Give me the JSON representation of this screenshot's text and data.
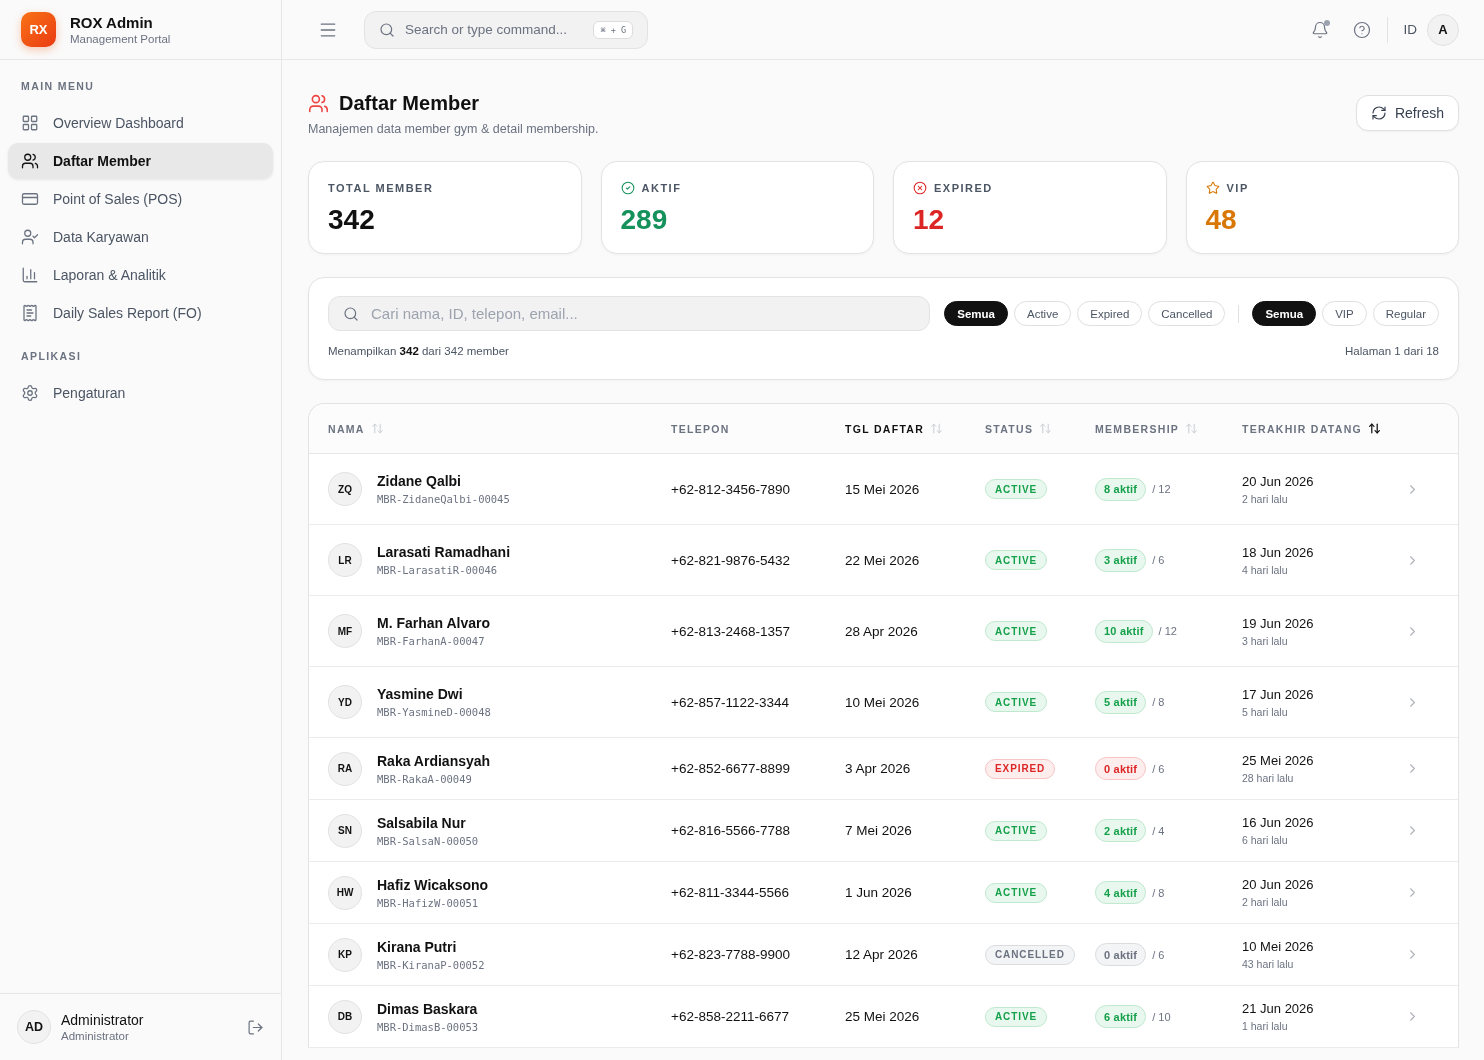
{
  "brand": {
    "logo": "RX",
    "name": "ROX Admin",
    "subtitle": "Management Portal"
  },
  "sidebar": {
    "sections": [
      {
        "title": "MAIN MENU",
        "items": [
          {
            "label": "Overview Dashboard",
            "kind": "dashboard",
            "selected": false
          },
          {
            "label": "Daftar Member",
            "kind": "members",
            "selected": true
          },
          {
            "label": "Point of Sales (POS)",
            "kind": "pos",
            "selected": false
          },
          {
            "label": "Data Karyawan",
            "kind": "employees",
            "selected": false
          },
          {
            "label": "Laporan & Analitik",
            "kind": "reports",
            "selected": false
          },
          {
            "label": "Daily Sales Report (FO)",
            "kind": "sales-report",
            "selected": false
          }
        ]
      },
      {
        "title": "APLIKASI",
        "items": [
          {
            "label": "Pengaturan",
            "kind": "settings",
            "selected": false
          }
        ]
      }
    ],
    "user": {
      "initials": "AD",
      "name": "Administrator",
      "role": "Administrator"
    }
  },
  "topbar": {
    "search": {
      "placeholder": "Search or type command...",
      "shortcut": "⌘ + G"
    },
    "notifications": {
      "unread": true
    },
    "language": "ID",
    "avatar": "A"
  },
  "page": {
    "title": "Daftar Member",
    "subtitle": "Manajemen data member gym & detail membership.",
    "refresh_button": "Refresh"
  },
  "stats": [
    {
      "kind": "total",
      "label": "TOTAL MEMBER",
      "value": "342"
    },
    {
      "kind": "active",
      "label": "AKTIF",
      "value": "289"
    },
    {
      "kind": "expired",
      "label": "EXPIRED",
      "value": "12"
    },
    {
      "kind": "vip",
      "label": "VIP",
      "value": "48"
    }
  ],
  "filters": {
    "search": {
      "placeholder": "Cari nama, ID, telepon, email..."
    },
    "status": [
      {
        "label": "Semua",
        "selected": true
      },
      {
        "label": "Active",
        "selected": false
      },
      {
        "label": "Expired",
        "selected": false
      },
      {
        "label": "Cancelled",
        "selected": false
      }
    ],
    "tier": [
      {
        "label": "Semua",
        "selected": true
      },
      {
        "label": "VIP",
        "selected": false
      },
      {
        "label": "Regular",
        "selected": false
      }
    ],
    "summary": "Menampilkan **342** dari 342 member",
    "pagination": "Halaman 1 dari 18"
  },
  "table": {
    "columns": [
      {
        "label": "NAMA",
        "sortable": true,
        "sorted": false,
        "highlighted": false
      },
      {
        "label": "TELEPON",
        "sortable": false,
        "sorted": false,
        "highlighted": false
      },
      {
        "label": "TGL DAFTAR",
        "sortable": true,
        "sorted": false,
        "highlighted": true
      },
      {
        "label": "STATUS",
        "sortable": true,
        "sorted": false,
        "highlighted": false
      },
      {
        "label": "MEMBERSHIP",
        "sortable": true,
        "sorted": false,
        "highlighted": false
      },
      {
        "label": "TERAKHIR DATANG",
        "sortable": true,
        "sorted": true,
        "highlighted": false
      }
    ],
    "rows": [
      {
        "initials": "ZQ",
        "name": "Zidane Qalbi",
        "member_id": "MBR-ZidaneQalbi-00045",
        "phone": "+62-812-3456-7890",
        "joined": "15 Mei 2026",
        "status": {
          "label": "ACTIVE",
          "kind": "active"
        },
        "membership": {
          "label": "8 aktif",
          "kind": "active",
          "total": "/ 12"
        },
        "last_visit": {
          "date": "20 Jun 2026",
          "ago": "2 hari lalu"
        }
      },
      {
        "initials": "LR",
        "name": "Larasati Ramadhani",
        "member_id": "MBR-LarasatiR-00046",
        "phone": "+62-821-9876-5432",
        "joined": "22 Mei 2026",
        "status": {
          "label": "ACTIVE",
          "kind": "active"
        },
        "membership": {
          "label": "3 aktif",
          "kind": "active",
          "total": "/ 6"
        },
        "last_visit": {
          "date": "18 Jun 2026",
          "ago": "4 hari lalu"
        }
      },
      {
        "initials": "MF",
        "name": "M. Farhan Alvaro",
        "member_id": "MBR-FarhanA-00047",
        "phone": "+62-813-2468-1357",
        "joined": "28 Apr 2026",
        "status": {
          "label": "ACTIVE",
          "kind": "active"
        },
        "membership": {
          "label": "10 aktif",
          "kind": "active",
          "total": "/ 12"
        },
        "last_visit": {
          "date": "19 Jun 2026",
          "ago": "3 hari lalu"
        }
      },
      {
        "initials": "YD",
        "name": "Yasmine Dwi",
        "member_id": "MBR-YasmineD-00048",
        "phone": "+62-857-1122-3344",
        "joined": "10 Mei 2026",
        "status": {
          "label": "ACTIVE",
          "kind": "active"
        },
        "membership": {
          "label": "5 aktif",
          "kind": "active",
          "total": "/ 8"
        },
        "last_visit": {
          "date": "17 Jun 2026",
          "ago": "5 hari lalu"
        }
      },
      {
        "initials": "RA",
        "name": "Raka Ardiansyah",
        "member_id": "MBR-RakaA-00049",
        "phone": "+62-852-6677-8899",
        "joined": "3 Apr 2026",
        "status": {
          "label": "EXPIRED",
          "kind": "expired"
        },
        "membership": {
          "label": "0 aktif",
          "kind": "expired",
          "total": "/ 6"
        },
        "last_visit": {
          "date": "25 Mei 2026",
          "ago": "28 hari lalu"
        }
      },
      {
        "initials": "SN",
        "name": "Salsabila Nur",
        "member_id": "MBR-SalsaN-00050",
        "phone": "+62-816-5566-7788",
        "joined": "7 Mei 2026",
        "status": {
          "label": "ACTIVE",
          "kind": "active"
        },
        "membership": {
          "label": "2 aktif",
          "kind": "active",
          "total": "/ 4"
        },
        "last_visit": {
          "date": "16 Jun 2026",
          "ago": "6 hari lalu"
        }
      },
      {
        "initials": "HW",
        "name": "Hafiz Wicaksono",
        "member_id": "MBR-HafizW-00051",
        "phone": "+62-811-3344-5566",
        "joined": "1 Jun 2026",
        "status": {
          "label": "ACTIVE",
          "kind": "active"
        },
        "membership": {
          "label": "4 aktif",
          "kind": "active",
          "total": "/ 8"
        },
        "last_visit": {
          "date": "20 Jun 2026",
          "ago": "2 hari lalu"
        }
      },
      {
        "initials": "KP",
        "name": "Kirana Putri",
        "member_id": "MBR-KiranaP-00052",
        "phone": "+62-823-7788-9900",
        "joined": "12 Apr 2026",
        "status": {
          "label": "CANCELLED",
          "kind": "cancelled"
        },
        "membership": {
          "label": "0 aktif",
          "kind": "cancelled",
          "total": "/ 6"
        },
        "last_visit": {
          "date": "10 Mei 2026",
          "ago": "43 hari lalu"
        }
      },
      {
        "initials": "DB",
        "name": "Dimas Baskara",
        "member_id": "MBR-DimasB-00053",
        "phone": "+62-858-2211-6677",
        "joined": "25 Mei 2026",
        "status": {
          "label": "ACTIVE",
          "kind": "active"
        },
        "membership": {
          "label": "6 aktif",
          "kind": "active",
          "total": "/ 10"
        },
        "last_visit": {
          "date": "21 Jun 2026",
          "ago": "1 hari lalu"
        }
      }
    ]
  }
}
